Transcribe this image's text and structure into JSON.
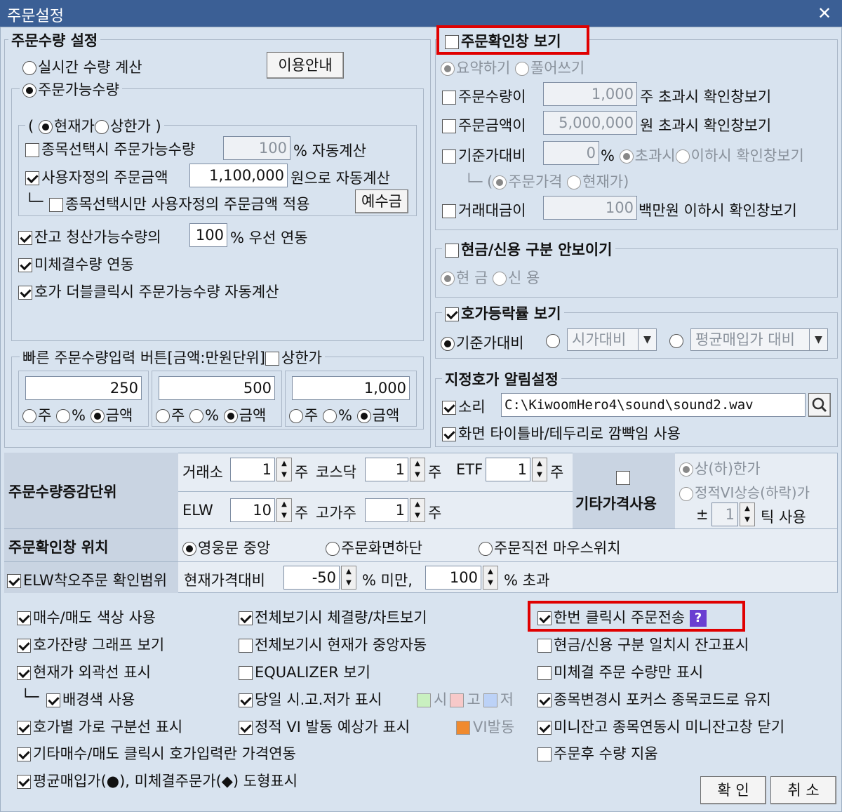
{
  "window": {
    "title": "주문설정",
    "close": "✕"
  },
  "left": {
    "group_title": "주문수량 설정",
    "radio_realtime": "실시간 수량 계산",
    "guide_button": "이용안내",
    "radio_orderable": "주문가능수량",
    "price_paren_open": "(",
    "radio_current": "현재가",
    "radio_upper": "상한가",
    "price_paren_close": ")",
    "item_select_label": "종목선택시 주문가능수량",
    "item_select_value": "100",
    "item_select_suffix": "% 자동계산",
    "custom_amount_label": "사용자정의 주문금액",
    "custom_amount_value": "1,100,000",
    "custom_amount_suffix": "원으로 자동계산",
    "tree_prefix": "└─",
    "apply_only_label": "종목선택시만 사용자정의 주문금액 적용",
    "deposit_button": "예수금",
    "balance_label": "잔고 청산가능수량의",
    "balance_value": "100",
    "balance_suffix": "% 우선 연동",
    "unfilled_label": "미체결수량 연동",
    "dblclick_label": "호가 더블클릭시 주문가능수량 자동계산",
    "quick_title": "빠른 주문수량입력 버튼[금액:만원단위]",
    "quick_upper": "상한가",
    "quick": [
      {
        "value": "250",
        "opt1": "주",
        "opt2": "%",
        "opt3": "금액"
      },
      {
        "value": "500",
        "opt1": "주",
        "opt2": "%",
        "opt3": "금액"
      },
      {
        "value": "1,000",
        "opt1": "주",
        "opt2": "%",
        "opt3": "금액"
      }
    ]
  },
  "right": {
    "confirm_title": "주문확인창 보기",
    "summary": "요약하기",
    "full": "풀어쓰기",
    "qty_label": "주문수량이",
    "qty_value": "1,000",
    "qty_suffix": "주 초과시 확인창보기",
    "amt_label": "주문금액이",
    "amt_value": "5,000,000",
    "amt_suffix": "원 초과시 확인창보기",
    "base_label": "기준가대비",
    "base_value": "0",
    "base_pct": "%",
    "base_over": "초과시",
    "base_under": "이하시 확인창보기",
    "base_tree": "└─",
    "base_paren_open": "(",
    "base_order_price": "주문가격",
    "base_current": "현재가",
    "base_paren_close": ")",
    "trade_label": "거래대금이",
    "trade_value": "100",
    "trade_suffix": "백만원 이하시 확인창보기",
    "cash_title": "현금/신용 구분 안보이기",
    "cash": "현 금",
    "credit": "신 용",
    "rate_title": "호가등락률 보기",
    "rate_base": "기준가대비",
    "rate_open": "시가대비",
    "rate_avg": "평균매입가 대비",
    "alarm_title": "지정호가 알림설정",
    "sound_label": "소리",
    "sound_path": "C:\\KiwoomHero4\\sound\\sound2.wav",
    "blink_label": "화면 타이틀바/테두리로 깜빡임 사용"
  },
  "increment": {
    "label": "주문수량증감단위",
    "exchange": "거래소",
    "exchange_v": "1",
    "unit": "주",
    "kosdaq": "코스닥",
    "kosdaq_v": "1",
    "etf": "ETF",
    "etf_v": "1",
    "elw": "ELW",
    "elw_v": "10",
    "high": "고가주",
    "high_v": "1",
    "other_label": "기타가격사용",
    "upper_lower": "상(하)한가",
    "static_vi": "정적VI상승(하락)가",
    "pm": "±",
    "tick_v": "1",
    "tick_suffix": "틱 사용"
  },
  "position": {
    "label": "주문확인창 위치",
    "opt1": "영웅문 중앙",
    "opt2": "주문화면하단",
    "opt3": "주문직전 마우스위치"
  },
  "elw_range": {
    "label": "ELW착오주문 확인범위",
    "cur": "현재가격대비",
    "low": "-50",
    "low_suffix": "% 미만,",
    "high": "100",
    "high_suffix": "% 초과"
  },
  "bottom": {
    "col1": [
      "매수/매도 색상 사용",
      "호가잔량 그래프 보기",
      "현재가 외곽선 표시",
      "배경색 사용",
      "호가별 가로 구분선 표시",
      "기타매수/매도 클릭시 호가입력란 가격연동",
      "평균매입가(●), 미체결주문가(◆) 도형표시"
    ],
    "tree_prefix": "└─",
    "col2": [
      "전체보기시 체결량/차트보기",
      "전체보기시 현재가 중앙자동",
      "EQUALIZER 보기",
      "당일 시.고.저가 표시",
      "정적 VI 발동 예상가 표시"
    ],
    "hlc": [
      "시",
      "고",
      "저"
    ],
    "vi": "VI발동",
    "col3": [
      "한번 클릭시 주문전송",
      "현금/신용 구분 일치시 잔고표시",
      "미체결 주문 수량만 표시",
      "종목변경시 포커스 종목코드로 유지",
      "미니잔고 종목연동시 미니잔고창 닫기",
      "주문후 수량 지움"
    ],
    "qmark": "?",
    "ok": "확 인",
    "cancel": "취 소"
  }
}
